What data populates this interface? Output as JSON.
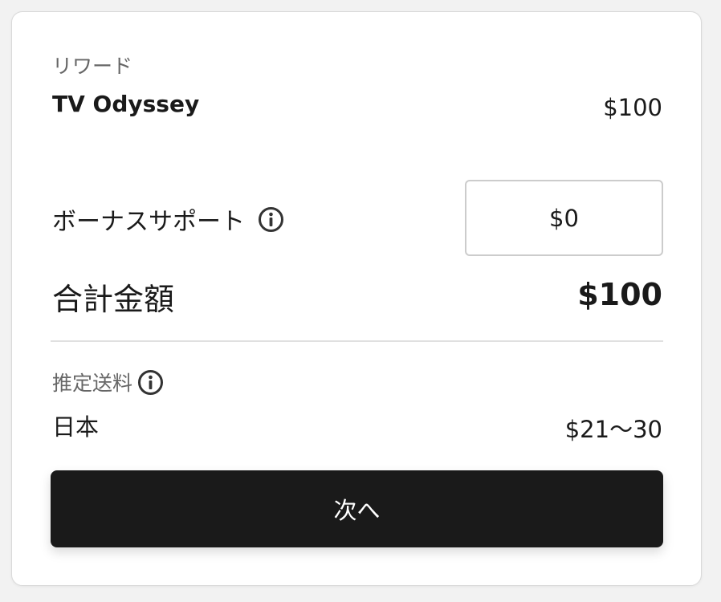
{
  "reward": {
    "section_label": "リワード",
    "name": "TV Odyssey",
    "price": "$100"
  },
  "bonus_support": {
    "label": "ボーナスサポート",
    "value": "$0",
    "info_icon": "info-icon"
  },
  "total": {
    "label": "合計金額",
    "value": "$100"
  },
  "shipping": {
    "label": "推定送料",
    "info_icon": "info-icon",
    "country": "日本",
    "price": "$21〜30"
  },
  "next_button": {
    "label": "次へ"
  },
  "colors": {
    "button_bg": "#1a1a1a",
    "button_text": "#ffffff",
    "muted_text": "#666666",
    "border": "#cccccc"
  }
}
